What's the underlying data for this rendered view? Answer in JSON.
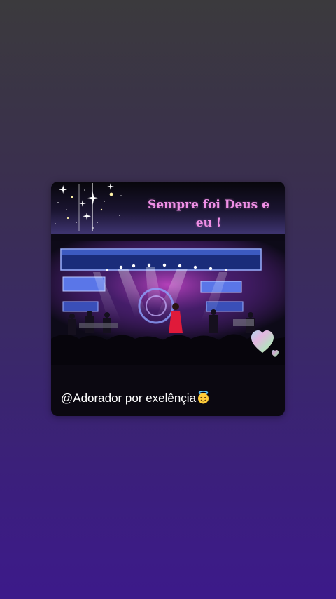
{
  "story": {
    "title": "Sempre foi Deus e eu !",
    "caption": "@Adorador por exelênçia",
    "caption_emoji_icon": "smiling-face-with-halo-icon"
  },
  "colors": {
    "title": "#f08fe6",
    "caption": "#ffffff",
    "background_top": "#3b3a3d",
    "background_bottom": "#3c1a8a"
  }
}
